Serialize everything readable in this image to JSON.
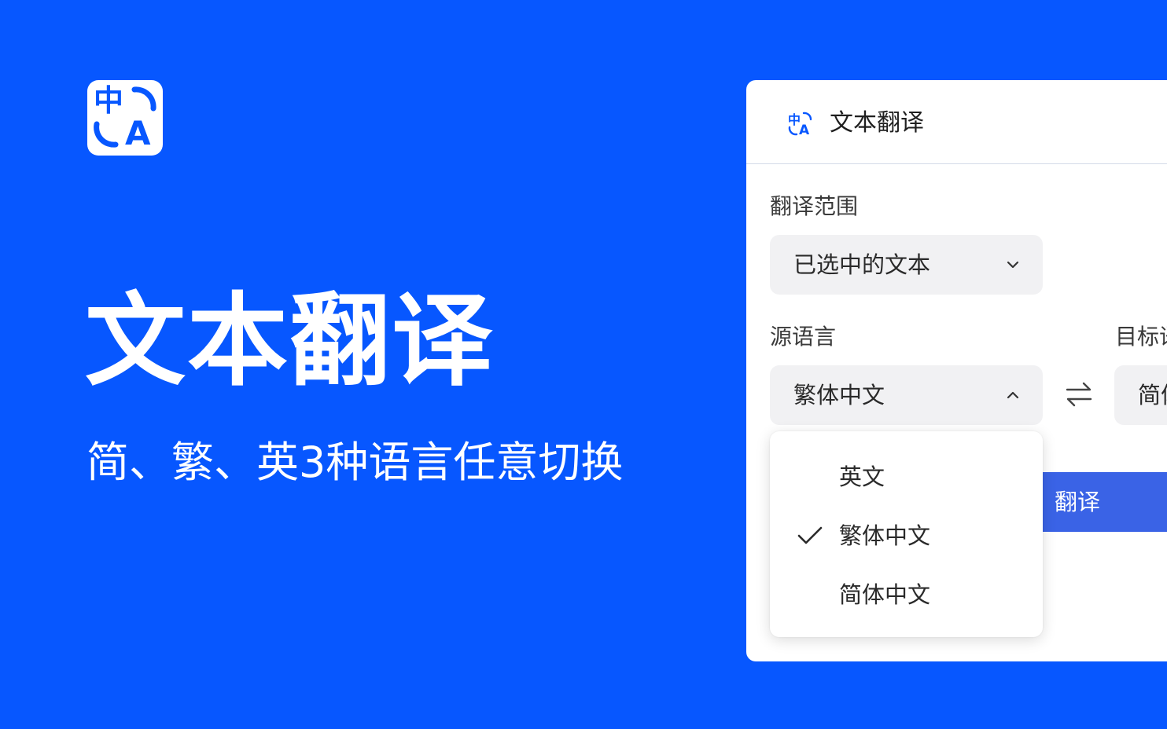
{
  "hero": {
    "logo_zh": "中",
    "logo_en": "A",
    "title": "文本翻译",
    "subtitle": "简、繁、英3种语言任意切换"
  },
  "panel": {
    "icon_zh": "中",
    "icon_en": "A",
    "title": "文本翻译",
    "range_label": "翻译范围",
    "range_value": "已选中的文本",
    "source_label": "源语言",
    "source_value": "繁体中文",
    "target_label": "目标语言",
    "target_value": "简体中文",
    "translate_label": "翻译",
    "source_options": [
      {
        "label": "英文",
        "selected": false
      },
      {
        "label": "繁体中文",
        "selected": true
      },
      {
        "label": "简体中文",
        "selected": false
      }
    ]
  },
  "colors": {
    "background": "#0757ff",
    "button": "#3a63e6",
    "select_bg": "#f1f1f3"
  },
  "icons": {
    "logo": "translate-icon",
    "range_chevron": "chevron-down-icon",
    "source_chevron": "chevron-up-icon",
    "swap": "swap-icon",
    "check": "check-icon"
  }
}
